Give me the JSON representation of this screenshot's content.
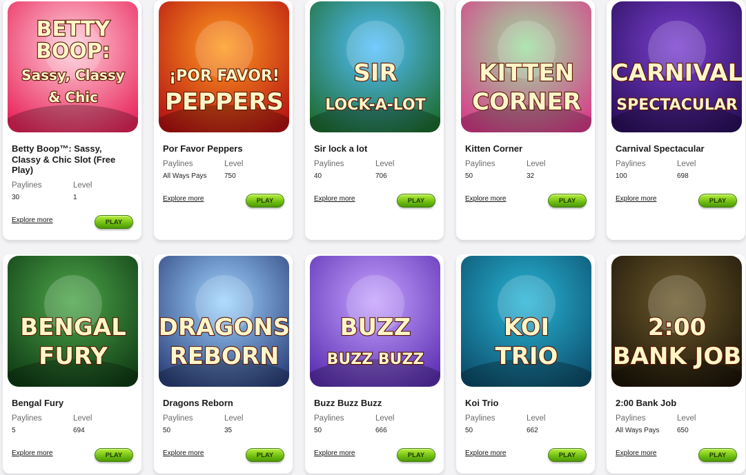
{
  "labels": {
    "paylines": "Paylines",
    "level": "Level",
    "explore": "Explore more",
    "play": "PLAY"
  },
  "games": [
    {
      "title": "Betty Boop™: Sassy, Classy & Chic Slot (Free Play)",
      "paylines": "30",
      "level": "1",
      "art_lines": [
        "BETTY",
        "BOOP:",
        "Sassy, Classy",
        "& Chic"
      ],
      "colors": [
        "#ffd0da",
        "#e8245a"
      ]
    },
    {
      "title": "Por Favor Peppers",
      "paylines": "All Ways Pays",
      "level": "750",
      "art_lines": [
        "¡POR FAVOR!",
        "PEPPERS"
      ],
      "colors": [
        "#ff9a1f",
        "#b51212"
      ]
    },
    {
      "title": "Sir lock a lot",
      "paylines": "40",
      "level": "706",
      "art_lines": [
        "SIR",
        "LOCK-A-LOT"
      ],
      "colors": [
        "#54c0ff",
        "#1d6c2e"
      ]
    },
    {
      "title": "Kitten Corner",
      "paylines": "50",
      "level": "32",
      "art_lines": [
        "KITTEN",
        "CORNER"
      ],
      "colors": [
        "#9de0a0",
        "#d83b8a"
      ]
    },
    {
      "title": "Carnival Spectacular",
      "paylines": "100",
      "level": "698",
      "art_lines": [
        "CARNIVAL",
        "SPECTACULAR"
      ],
      "colors": [
        "#7a3fd0",
        "#2a0f5c"
      ]
    },
    {
      "title": "Bengal Fury",
      "paylines": "5",
      "level": "694",
      "art_lines": [
        "BENGAL",
        "FURY"
      ],
      "colors": [
        "#4da64a",
        "#0f3b14"
      ]
    },
    {
      "title": "Dragons Reborn",
      "paylines": "50",
      "level": "35",
      "art_lines": [
        "DRAGONS",
        "REBORN"
      ],
      "colors": [
        "#9fd4ff",
        "#2b3f7a"
      ]
    },
    {
      "title": "Buzz Buzz Buzz",
      "paylines": "50",
      "level": "666",
      "art_lines": [
        "BUZZ",
        "BUZZ BUZZ"
      ],
      "colors": [
        "#c6a3ff",
        "#5b2fb2"
      ]
    },
    {
      "title": "Koi Trio",
      "paylines": "50",
      "level": "662",
      "art_lines": [
        "KOI",
        "TRIO"
      ],
      "colors": [
        "#29b5d6",
        "#0c4d6b"
      ]
    },
    {
      "title": "2:00 Bank Job",
      "paylines": "All Ways Pays",
      "level": "650",
      "art_lines": [
        "2:00",
        "BANK JOB"
      ],
      "colors": [
        "#6b5a2b",
        "#1c1408"
      ]
    }
  ]
}
